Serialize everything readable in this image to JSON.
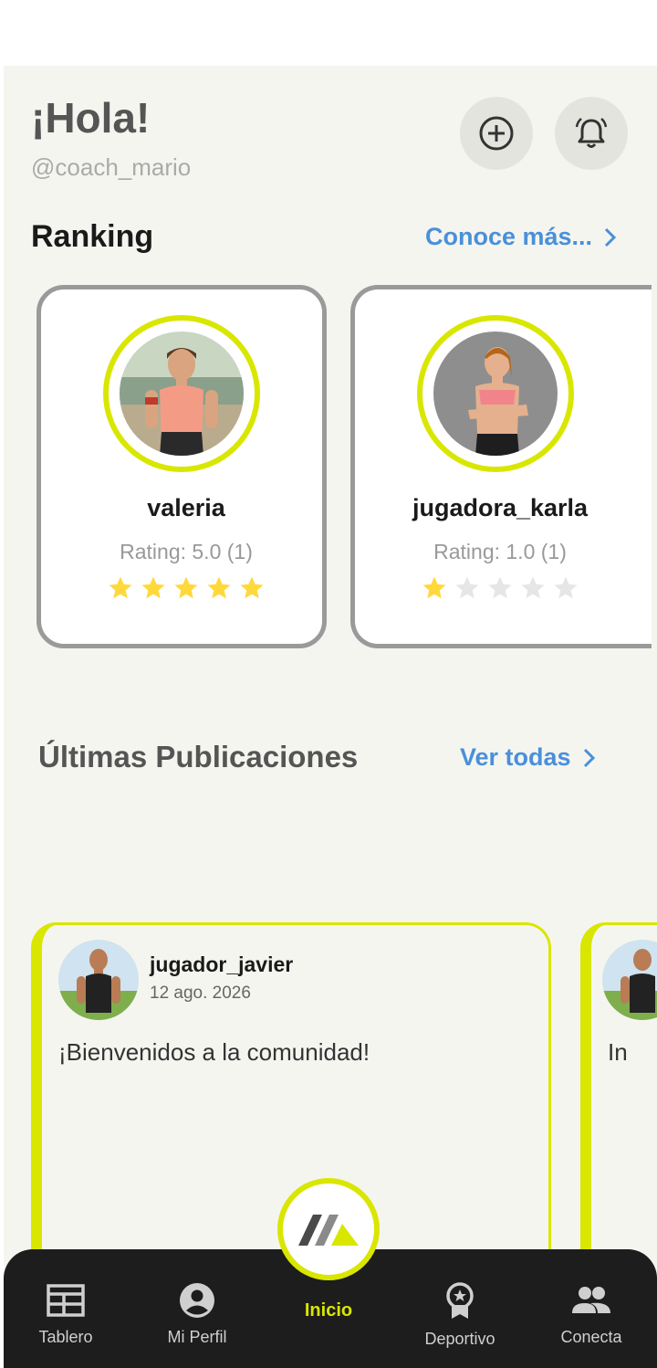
{
  "header": {
    "greeting": "¡Hola!",
    "username": "@coach_mario",
    "icons": [
      "add-circle-icon",
      "bell-icon"
    ]
  },
  "ranking": {
    "title": "Ranking",
    "link": "Conoce más...",
    "players": [
      {
        "name": "valeria",
        "rating_text": "Rating: 5.0 (1)",
        "stars": 5,
        "max_stars": 5
      },
      {
        "name": "jugadora_karla",
        "rating_text": "Rating: 1.0 (1)",
        "stars": 1,
        "max_stars": 5
      }
    ]
  },
  "publications": {
    "title": "Últimas Publicaciones",
    "link": "Ver todas",
    "posts": [
      {
        "user": "jugador_javier",
        "date": "12 ago. 2026",
        "text": "¡Bienvenidos a la comunidad!"
      },
      {
        "user": "",
        "date": "",
        "text": "In"
      }
    ]
  },
  "nav": {
    "items": [
      {
        "label": "Tablero",
        "icon": "table-icon"
      },
      {
        "label": "Mi Perfil",
        "icon": "user-icon"
      },
      {
        "label": "Inicio",
        "icon": "logo-icon"
      },
      {
        "label": "Deportivo",
        "icon": "award-icon"
      },
      {
        "label": "Conecta",
        "icon": "people-icon"
      }
    ]
  },
  "colors": {
    "accent": "#d9e600",
    "link": "#4a90d9",
    "star": "#ffd93b",
    "star_empty": "#e6e6e6",
    "nav_bg": "#1d1d1d"
  }
}
